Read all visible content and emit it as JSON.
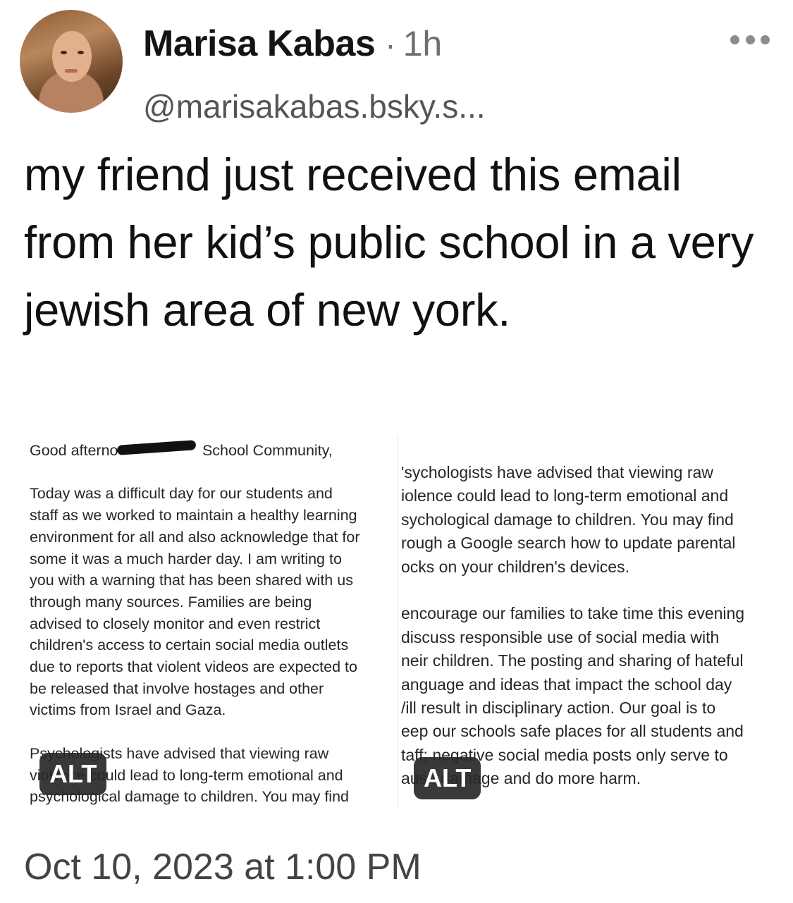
{
  "post": {
    "author": {
      "display_name": "Marisa Kabas",
      "separator": "·",
      "time_ago": "1h",
      "handle": "@marisakabas.bsky.s..."
    },
    "text": "my friend just received this email from her kid’s public school in a very jewish area of new york.",
    "images": [
      {
        "alt_label": "ALT",
        "lines": [
          "Good afterno                    School Community,",
          "",
          "Today was a difficult day for our students and",
          "staff as we worked to maintain a healthy learning",
          "environment for all and also acknowledge that for",
          "some it was a much harder day. I am writing to",
          "you with a warning that has been shared with us",
          "through many sources. Families are being",
          "advised to closely monitor and even restrict",
          "children's access to certain social media outlets",
          "due to reports that violent videos are expected to",
          "be released that involve hostages and other",
          "victims from Israel and Gaza.",
          "",
          "Psychologists have advised that viewing raw",
          "violence could lead to long-term emotional and",
          "psychological damage to children. You may find"
        ]
      },
      {
        "alt_label": "ALT",
        "lines": [
          "'sychologists have advised that viewing raw",
          "iolence could lead to long-term emotional and",
          "sychological damage to children. You may find",
          "rough a Google search how to update parental",
          "ocks on your children's devices.",
          "",
          "encourage our families to take time this evening",
          "discuss responsible use of social media with",
          "neir children. The posting and sharing of hateful",
          "anguage and ideas that impact the school day",
          "/ill result in disciplinary action. Our goal is to",
          "eep our schools safe places for all students and",
          "taff; negative social media posts only serve to",
          "ause damage and do more harm."
        ]
      }
    ],
    "timestamp": "Oct 10, 2023 at 1:00 PM"
  }
}
